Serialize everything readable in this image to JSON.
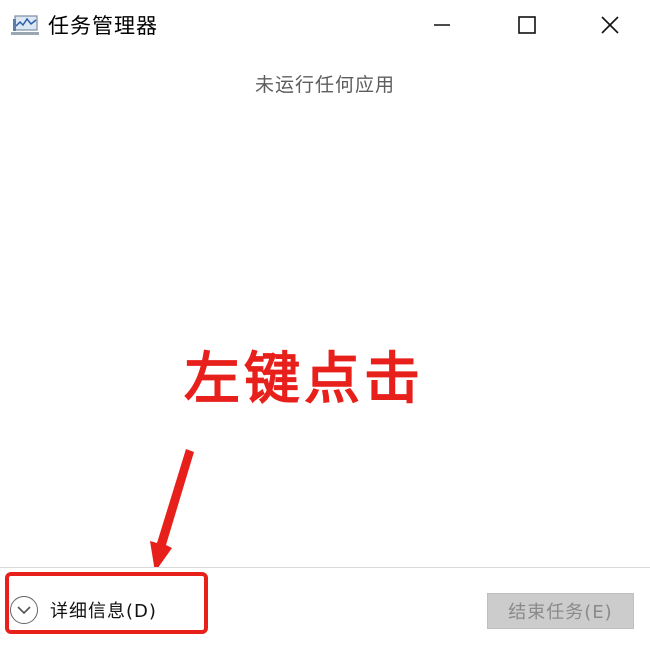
{
  "window": {
    "title": "任务管理器",
    "icon": "task-manager-icon",
    "controls": [
      "minimize-icon",
      "maximize-icon",
      "close-icon"
    ]
  },
  "main": {
    "empty_message": "未运行任何应用"
  },
  "annotation": {
    "text": "左键点击",
    "color": "#e8201c"
  },
  "footer": {
    "details_label": "详细信息(D)",
    "end_task_label": "结束任务(E)",
    "end_task_disabled": true
  }
}
